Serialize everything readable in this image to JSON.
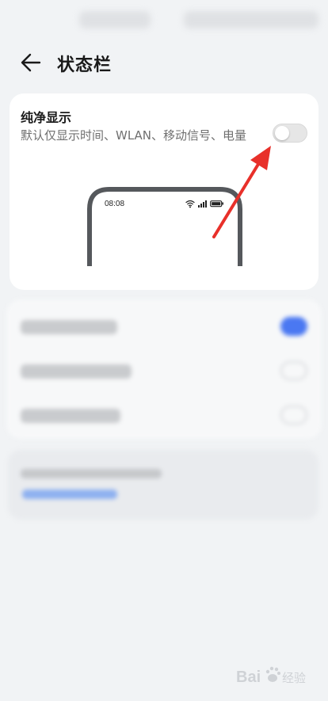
{
  "header": {
    "title": "状态栏",
    "back_icon": "arrow-left-icon"
  },
  "pure_display": {
    "title": "纯净显示",
    "description": "默认仅显示时间、WLAN、移动信号、电量",
    "enabled": false,
    "preview": {
      "time": "08:08",
      "icons": [
        "wifi-icon",
        "signal-icon",
        "battery-icon"
      ]
    }
  },
  "annotation": {
    "arrow_color": "#e8302a",
    "icon": "red-arrow-icon"
  },
  "colors": {
    "background": "#f1f3f5",
    "card": "#ffffff",
    "accent": "#3b6ff5",
    "toggle_off": "#e6e6e6"
  },
  "watermark": {
    "icon": "baidu-jingyan-logo",
    "text": "Bai 经验"
  }
}
